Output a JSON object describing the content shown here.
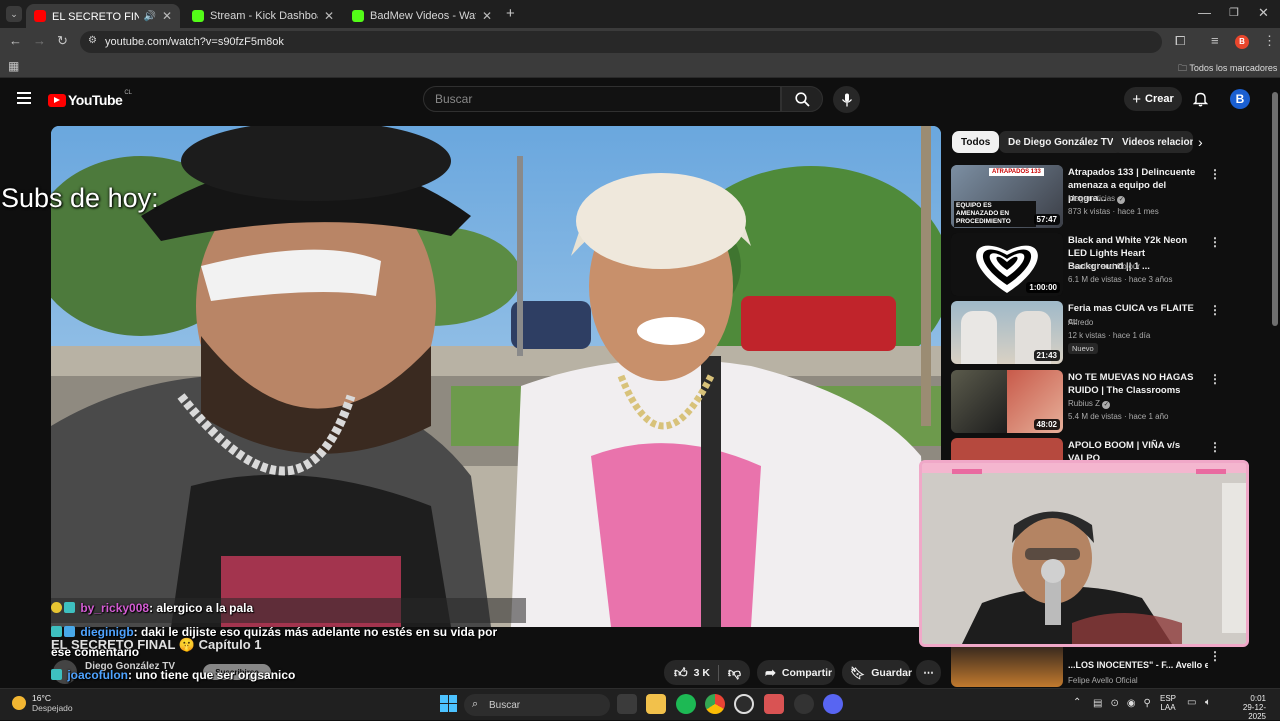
{
  "browser": {
    "tabs": [
      {
        "title": "EL SECRETO FINAL🤫 Capít",
        "active": true
      },
      {
        "title": "Stream - Kick Dashboard",
        "active": false
      },
      {
        "title": "BadMew Videos - Watch On-De",
        "active": false
      }
    ],
    "url": "youtube.com/watch?v=s90fzF5m8ok",
    "bookmarks_label": "Todos los marcadores",
    "profile_initial": "B"
  },
  "youtube": {
    "logo_text": "YouTube",
    "region": "CL",
    "search_placeholder": "Buscar",
    "create_label": "Crear"
  },
  "overlay": {
    "subs_title": "Subs de hoy:"
  },
  "chat": [
    {
      "user": "by_ricky008",
      "message": ": alergico a la pala"
    },
    {
      "user": "dieginigb",
      "message": ": daki le dijiste eso quizás más adelante no estés en su vida por"
    },
    {
      "user": "",
      "message": "ese comentario"
    },
    {
      "user": "joacofulon",
      "message": ": uno tiene que ser orgsanico"
    }
  ],
  "video_info": {
    "title_partial": "EL SECRETO FINAL 🤫 Capítulo 1",
    "channel": "Diego González TV",
    "subscribe_label": "Suscribirse",
    "likes": "3 K",
    "share_label": "Compartir",
    "save_label": "Guardar"
  },
  "chips": [
    "Todos",
    "De Diego González TV",
    "Videos relacion"
  ],
  "recommendations": [
    {
      "title": "Atrapados 133 | Delincuente amenaza a equipo del progra...",
      "channel": "Meganoticias",
      "verified": true,
      "meta": "873 k vistas · hace 1 mes",
      "duration": "57:47",
      "thumb_text": "EQUIPO ES AMENAZADO EN PROCEDIMIENTO",
      "thumb_tag": "ATRAPADOS 133"
    },
    {
      "title": "Black and White Y2k Neon LED Lights Heart Background || 1 ...",
      "channel": "Gradient and Colour",
      "verified": false,
      "meta": "6.1 M de vistas · hace 3 años",
      "duration": "1:00:00"
    },
    {
      "title": "Feria mas CUICA vs FLAITE",
      "title_suffix": "CL",
      "channel": "Alfredo",
      "verified": false,
      "meta": "12 k vistas · hace 1 día",
      "badge": "Nuevo",
      "duration": "21:43"
    },
    {
      "title": "NO TE MUEVAS NO HAGAS RUIDO | The Classrooms",
      "channel": "Rubius Z",
      "verified": true,
      "meta": "5.4 M de vistas · hace 1 año",
      "duration": "48:02"
    },
    {
      "title": "APOLO BOOM | VIÑA v/s VALPO",
      "channel": "",
      "meta": "",
      "duration": ""
    },
    {
      "title": "...LOS INOCENTES\" - F... Avello en vivo desde el ...",
      "channel": "Felipe Avello Oficial",
      "meta": "",
      "duration": ""
    }
  ],
  "taskbar": {
    "weather_temp": "16°C",
    "weather_desc": "Despejado",
    "search_label": "Buscar",
    "lang": "ESP",
    "lang_sub": "LAA",
    "time": "0:01",
    "date": "29-12-2025"
  },
  "colors": {
    "yt_red": "#ff0000",
    "bg": "#0f0f0f",
    "webcam_frame": "#f0a8c8",
    "chat_user_pink": "#d35cd3",
    "chat_user_blue": "#4fa3ff"
  }
}
